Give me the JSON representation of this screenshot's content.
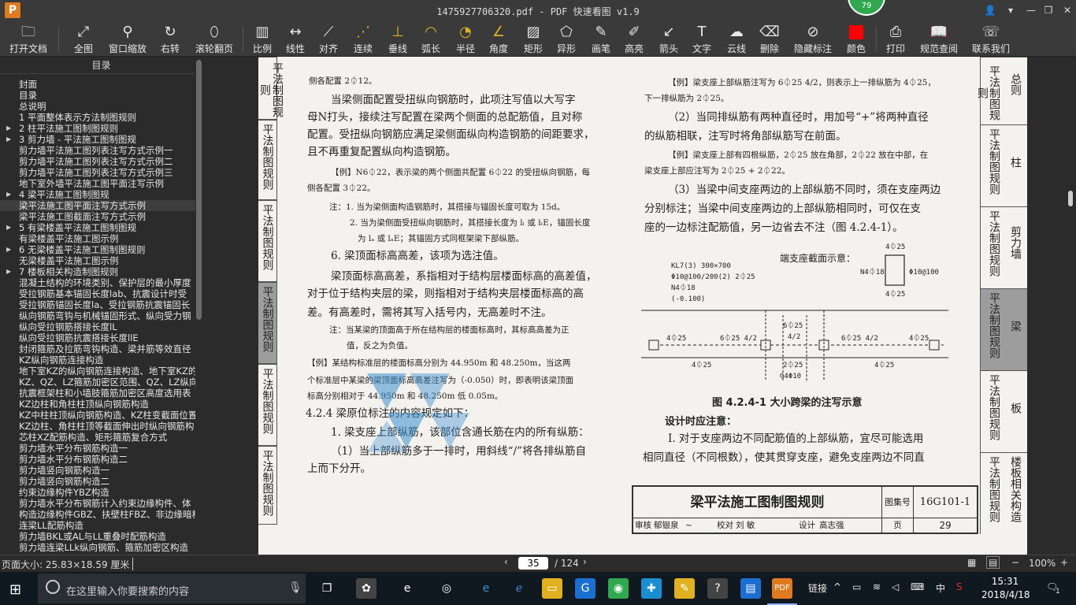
{
  "window": {
    "title": "1475927706320.pdf - PDF 快速看图 v1.9",
    "logo": "P",
    "badge": "79"
  },
  "toolbar": {
    "items": [
      {
        "label": "打开文档",
        "icon": "folder-icon"
      },
      {
        "label": "全图",
        "icon": "fit-page-icon"
      },
      {
        "label": "窗口缩放",
        "icon": "zoom-window-icon"
      },
      {
        "label": "右转",
        "icon": "rotate-right-icon"
      },
      {
        "label": "滚轮翻页",
        "icon": "mouse-wheel-icon"
      },
      {
        "label": "比例",
        "icon": "scale-icon"
      },
      {
        "label": "线性",
        "icon": "linear-measure-icon"
      },
      {
        "label": "对齐",
        "icon": "aligned-measure-icon"
      },
      {
        "label": "连续",
        "icon": "continuous-measure-icon"
      },
      {
        "label": "垂线",
        "icon": "perpendicular-icon"
      },
      {
        "label": "弧长",
        "icon": "arc-length-icon"
      },
      {
        "label": "半径",
        "icon": "radius-icon"
      },
      {
        "label": "角度",
        "icon": "angle-icon"
      },
      {
        "label": "矩形",
        "icon": "rectangle-area-icon"
      },
      {
        "label": "异形",
        "icon": "polygon-area-icon"
      },
      {
        "label": "画笔",
        "icon": "pen-icon"
      },
      {
        "label": "高亮",
        "icon": "highlight-icon"
      },
      {
        "label": "箭头",
        "icon": "arrow-icon"
      },
      {
        "label": "文字",
        "icon": "text-icon"
      },
      {
        "label": "云线",
        "icon": "cloud-line-icon"
      },
      {
        "label": "删除",
        "icon": "eraser-icon"
      },
      {
        "label": "隐藏标注",
        "icon": "hide-annotation-icon"
      },
      {
        "label": "颜色",
        "icon": "color-swatch-icon",
        "color": "#ff0000"
      },
      {
        "label": "打印",
        "icon": "print-icon"
      },
      {
        "label": "规范查阅",
        "icon": "book-icon"
      },
      {
        "label": "联系我们",
        "icon": "contact-icon"
      }
    ]
  },
  "sidebar": {
    "header": "目录",
    "items": [
      {
        "label": "封面",
        "indent": 1
      },
      {
        "label": "目录",
        "indent": 1
      },
      {
        "label": "总说明",
        "indent": 1
      },
      {
        "label": "1 平面整体表示方法制图规则",
        "indent": 1
      },
      {
        "label": "2 柱平法施工图制图规则",
        "indent": 1,
        "arrow": true
      },
      {
        "label": "3 剪力墙 - 平法施工图制图规",
        "indent": 1,
        "arrow": true
      },
      {
        "label": "剪力墙平法施工图列表注写方式示例一",
        "indent": 1
      },
      {
        "label": "剪力墙平法施工图列表注写方式示例二",
        "indent": 1
      },
      {
        "label": "剪力墙平法施工图列表注写方式示例三",
        "indent": 1
      },
      {
        "label": "地下室外墙平法施工图平面注写示例",
        "indent": 1
      },
      {
        "label": "4 梁平法施工图制图规",
        "indent": 1,
        "arrow": true
      },
      {
        "label": "梁平法施工图平面注写方式示例",
        "indent": 1,
        "selected": true
      },
      {
        "label": "梁平法施工图截面注写方式示例",
        "indent": 1
      },
      {
        "label": "5 有梁楼盖平法施工图制图规",
        "indent": 1,
        "arrow": true
      },
      {
        "label": "有梁楼盖平法施工图示例",
        "indent": 1
      },
      {
        "label": "6 无梁楼盖平法施工图制图规则",
        "indent": 1,
        "arrow": true
      },
      {
        "label": "无梁楼盖平法施工图示例",
        "indent": 1
      },
      {
        "label": "7 楼板相关构造制图规则",
        "indent": 1,
        "arrow": true
      },
      {
        "label": "混凝土结构的环境类别、保护层的最小厚度",
        "indent": 1
      },
      {
        "label": "受拉钢筋基本锚固长度lab、抗震设计时受",
        "indent": 1
      },
      {
        "label": "受拉钢筋锚固长度la、受拉钢筋抗震锚固长",
        "indent": 1
      },
      {
        "label": "纵向钢筋弯钩与机械锚固形式、纵向受力钢",
        "indent": 1
      },
      {
        "label": "纵向受拉钢筋搭接长度lL",
        "indent": 1
      },
      {
        "label": "纵向受拉钢筋抗震搭接长度llE",
        "indent": 1
      },
      {
        "label": "封闭箍筋及拉筋弯钩构造、梁并筋等效直径",
        "indent": 1
      },
      {
        "label": "KZ纵向钢筋连接构造",
        "indent": 1
      },
      {
        "label": "地下室KZ的纵向钢筋连接构造、地下室KZ的",
        "indent": 1
      },
      {
        "label": "KZ、QZ、LZ箍筋加密区范围、QZ、LZ纵向钢",
        "indent": 1
      },
      {
        "label": "抗震框架柱和小墙肢箍筋加密区高度选用表",
        "indent": 1
      },
      {
        "label": "KZ边柱和角柱柱顶纵向钢筋构造",
        "indent": 1
      },
      {
        "label": "KZ中柱柱顶纵向钢筋构造、KZ柱变截面位置",
        "indent": 1
      },
      {
        "label": "KZ边柱、角柱柱顶等截面伸出时纵向钢筋构",
        "indent": 1
      },
      {
        "label": "芯柱XZ配筋构造、矩形箍筋复合方式",
        "indent": 1
      },
      {
        "label": "剪力墙水平分布钢筋构造一",
        "indent": 1
      },
      {
        "label": "剪力墙水平分布钢筋构造二",
        "indent": 1
      },
      {
        "label": "剪力墙竖向钢筋构造一",
        "indent": 1
      },
      {
        "label": "剪力墙竖向钢筋构造二",
        "indent": 1
      },
      {
        "label": "约束边缘构件YBZ构造",
        "indent": 1
      },
      {
        "label": "剪力墙水平分布钢筋计入约束边缘构件、体",
        "indent": 1
      },
      {
        "label": "构造边缘构件GBZ、扶壁柱FBZ、非边缘暗柱",
        "indent": 1
      },
      {
        "label": "连梁LL配筋构造",
        "indent": 1
      },
      {
        "label": "剪力墙BKL或AL与LL重叠时配筋构造",
        "indent": 1
      },
      {
        "label": "剪力墙连梁LLk纵向钢筋、箍筋加密区构造",
        "indent": 1
      }
    ]
  },
  "page": {
    "left_tabs": [
      "平法制图规则",
      "平法制图规则",
      "平法制图规则",
      "平法制图规则",
      "平法制图规则",
      "平法制图规则"
    ],
    "right_tabs": [
      {
        "vert": "平法制图规则",
        "name": "总则"
      },
      {
        "vert": "平法制图规则",
        "name": "柱"
      },
      {
        "vert": "平法制图规则",
        "name": "剪力墙"
      },
      {
        "vert": "平法制图规则",
        "name": "梁",
        "active": true
      },
      {
        "vert": "平法制图规则",
        "name": "板"
      },
      {
        "vert": "平法制图规则",
        "name": "楼板相关构造"
      }
    ],
    "left_text": [
      "侧各配置 2⏀12。",
      "当梁侧面配置受扭纵向钢筋时，此项注写值以大写字",
      "母N打头，接续注写配置在梁两个侧面的总配筋值，且对称",
      "配置。受扭纵向钢筋应满足梁侧面纵向构造钢筋的间距要求，",
      "且不再重复配置纵向构造钢筋。",
      "【例】N6⏀22，表示梁的两个侧面共配置 6⏀22 的受扭纵向钢筋，每",
      "侧各配置 3⏀22。",
      "注：1. 当为梁侧面构造钢筋时，其搭接与锚固长度可取为 15d。",
      "2. 当为梁侧面受扭纵向钢筋时，其搭接长度为 lₗ 或 lₗE，锚固长度",
      "为 lₐ 或 lₐE；其锚固方式同框架梁下部纵筋。",
      "6. 梁顶面标高高差，该项为选注值。",
      "梁顶面标高高差，系指相对于结构层楼面标高的高差值，",
      "对于位于结构夹层的梁，则指相对于结构夹层楼面标高的高",
      "差。有高差时，需将其写入括号内，无高差时不注。",
      "注：当某梁的顶面高于所在结构层的楼面标高时，其标高高差为正",
      "值，反之为负值。",
      "【例】某结构标准层的楼面标高分别为 44.950m 和 48.250m，当这两",
      "个标准层中某梁的梁顶面标高高差注写为（-0.050）时，即表明该梁顶面",
      "标高分别相对于 44.950m 和 48.250m 低 0.05m。",
      "4.2.4 梁原位标注的内容规定如下：",
      "1. 梁支座上部纵筋，该部位含通长筋在内的所有纵筋：",
      "（1）当上部纵筋多于一排时，用斜线“/”将各排纵筋自",
      "上而下分开。"
    ],
    "right_text": [
      "【例】梁支座上部纵筋注写为 6⏀25 4/2，则表示上一排纵筋为 4⏀25，",
      "下一排纵筋为 2⏀25。",
      "（2）当同排纵筋有两种直径时，用加号“+”将两种直径",
      "的纵筋相联，注写时将角部纵筋写在前面。",
      "【例】梁支座上部有四根纵筋，2⏀25 放在角部，2⏀22 放在中部，在",
      "梁支座上部应注写为 2⏀25 + 2⏀22。",
      "（3）当梁中间支座两边的上部纵筋不同时，须在支座两边",
      "分别标注；当梁中间支座两边的上部纵筋相同时，可仅在支",
      "座的一边标注配筋值，另一边省去不注（图 4.2.4-1）。",
      "图 4.2.4-1 大小跨梁的注写示意",
      "设计时应注意：",
      "Ⅰ. 对于支座两边不同配筋值的上部纵筋，宜尽可能选用",
      "相同直径（不同根数），使其贯穿支座，避免支座两边不同直"
    ],
    "figure": {
      "section_label": "端支座截面示意：",
      "beam_info": [
        "KL7(3) 300×700",
        "Φ10@100/200(2) 2⏀25",
        "N4⏀18",
        "(-0.100)"
      ],
      "sec_top": "4⏀25",
      "sec_side": "N4⏀18",
      "sec_stirrup": "Φ10@100",
      "sec_bot": "4⏀25",
      "labels_top": [
        "4⏀25",
        "6⏀25 4/2",
        "6⏀25",
        "4/2",
        "6⏀25 4/2",
        "4⏀25"
      ],
      "labels_bot": [
        "4⏀25",
        "2⏀25",
        "G4Φ10",
        "4⏀25"
      ]
    },
    "titleblock": {
      "title": "梁平法施工图制图规则",
      "atlas_label": "图集号",
      "atlas": "16G101-1",
      "review": "审核",
      "reviewer": "郁银泉",
      "check": "校对",
      "checker": "刘  敏",
      "design": "设计",
      "designer": "高志强",
      "page_label": "页",
      "page_no": "29"
    }
  },
  "statusbar": {
    "page_size": "页面大小: 25.83×18.59 厘米",
    "current_page": "35",
    "total": "/ 124",
    "zoom": "100%"
  },
  "taskbar": {
    "search_placeholder": "在这里输入你要搜索的内容",
    "tray_link": "链接",
    "ime": "中",
    "time": "15:31",
    "date": "2018/4/18",
    "notifications": "1"
  }
}
